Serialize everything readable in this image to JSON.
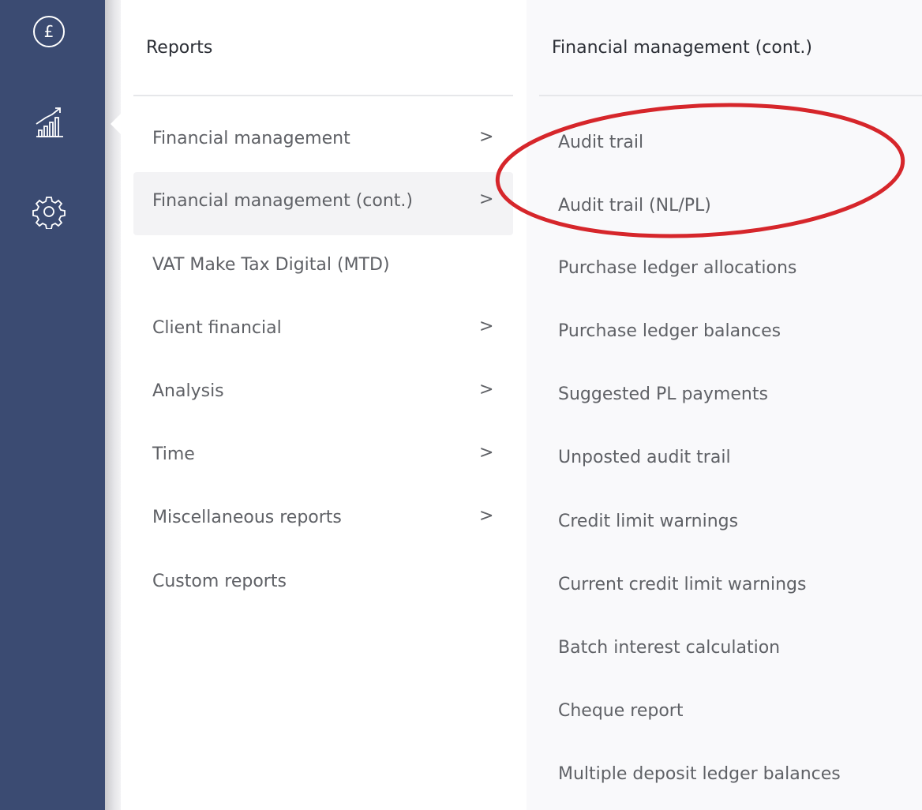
{
  "rail": {
    "icons": [
      "pound-coin-icon",
      "growth-chart-icon",
      "settings-gear-icon"
    ]
  },
  "reports": {
    "title": "Reports",
    "items": [
      {
        "label": "Financial management",
        "chevron": ">"
      },
      {
        "label": "Financial management (cont.)",
        "chevron": ">",
        "active": true
      },
      {
        "label": "VAT Make Tax Digital (MTD)",
        "chevron": ""
      },
      {
        "label": "Client financial",
        "chevron": ">"
      },
      {
        "label": "Analysis",
        "chevron": ">"
      },
      {
        "label": "Time",
        "chevron": ">"
      },
      {
        "label": "Miscellaneous reports",
        "chevron": ">"
      },
      {
        "label": "Custom reports",
        "chevron": ""
      }
    ]
  },
  "submenu": {
    "title": "Financial management (cont.)",
    "items": [
      "Audit trail",
      "Audit trail (NL/PL)",
      "Purchase ledger allocations",
      "Purchase ledger balances",
      "Suggested PL payments",
      "Unposted audit trail",
      "Credit limit warnings",
      "Current credit limit warnings",
      "Batch interest calculation",
      "Cheque report",
      "Multiple deposit ledger balances"
    ]
  },
  "colors": {
    "rail": "#3b4b72",
    "active_row": "#f3f3f5",
    "annotation_ellipse": "#d6262b"
  }
}
